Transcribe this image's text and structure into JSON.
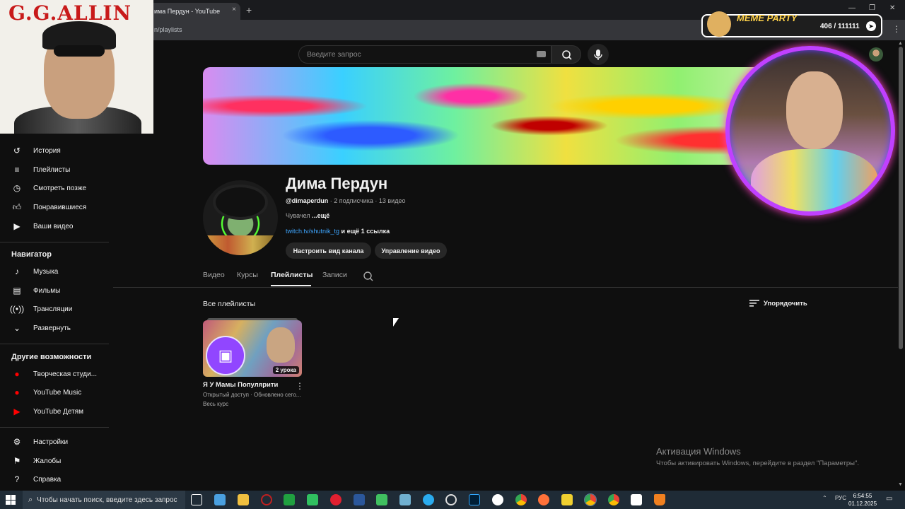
{
  "browser": {
    "tab_title": "има Пердун - YouTube",
    "tab_close": "×",
    "new_tab": "+",
    "url": "n/playlists",
    "win_min": "—",
    "win_max": "❐",
    "win_close": "✕",
    "menu": "⋮"
  },
  "search": {
    "placeholder": "Введите запрос"
  },
  "sidebar": {
    "items": [
      {
        "label": "История",
        "icon": "history-icon"
      },
      {
        "label": "Плейлисты",
        "icon": "playlists-icon"
      },
      {
        "label": "Смотреть позже",
        "icon": "watch-later-icon"
      },
      {
        "label": "Понравившиеся",
        "icon": "like-icon"
      },
      {
        "label": "Ваши видео",
        "icon": "your-videos-icon"
      }
    ],
    "navigator_heading": "Навигатор",
    "navigator": [
      {
        "label": "Музыка",
        "icon": "music-icon"
      },
      {
        "label": "Фильмы",
        "icon": "movies-icon"
      },
      {
        "label": "Трансляции",
        "icon": "live-icon"
      },
      {
        "label": "Развернуть",
        "icon": "chevron-down-icon"
      }
    ],
    "more_heading": "Другие возможности",
    "more": [
      {
        "label": "Творческая студи...",
        "icon": "studio-icon"
      },
      {
        "label": "YouTube Music",
        "icon": "youtube-music-icon"
      },
      {
        "label": "YouTube Детям",
        "icon": "youtube-kids-icon"
      }
    ],
    "bottom": [
      {
        "label": "Настройки",
        "icon": "gear-icon"
      },
      {
        "label": "Жалобы",
        "icon": "flag-icon"
      },
      {
        "label": "Справка",
        "icon": "help-icon"
      }
    ]
  },
  "channel": {
    "name": "Дима Пердун",
    "handle": "@dimaperdun",
    "stats": " · 2 подписчика · 13 видео",
    "description": "Чувачел ",
    "more": "...ещё",
    "link": "twitch.tv/shutnik_tg",
    "link_more": " и ещё 1 ссылка",
    "customize_button": "Настроить вид канала",
    "manage_button": "Управление видео"
  },
  "tabs": [
    "Видео",
    "Курсы",
    "Плейлисты",
    "Записи"
  ],
  "section": {
    "title": "Все плейлисты",
    "sort_label": "Упорядочить"
  },
  "playlist": {
    "title": "Я У Мамы Популярити",
    "meta": "Открытый доступ · Обновлено сегo...",
    "full_course": "Весь курс",
    "badge": "2 урока"
  },
  "overlays": {
    "gg_title": "G.G.ALLIN",
    "meme_label": "MEME PARTY",
    "meme_count": "406 / 111111"
  },
  "windows_activation": {
    "title": "Активация Windows",
    "subtitle": "Чтобы активировать Windows, перейдите в раздел \"Параметры\"."
  },
  "taskbar": {
    "search_placeholder": "Чтобы начать поиск, введите здесь запрос",
    "lang": "РУС",
    "time": "6:54:55",
    "date": "01.12.2025"
  }
}
